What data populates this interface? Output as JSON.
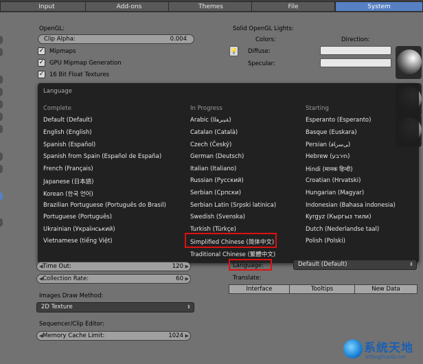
{
  "tabs": [
    "Input",
    "Add-ons",
    "Themes",
    "File",
    "System"
  ],
  "active_tab": "System",
  "opengl": {
    "heading": "OpenGL:",
    "clip_alpha_label": "Clip Alpha:",
    "clip_alpha_value": "0.004",
    "mipmaps_label": "Mipmaps",
    "gpu_mipmap_label": "GPU Mipmap Generation",
    "float_textures_label": "16 Bit Float Textures",
    "check_mark": "✓"
  },
  "solid_lights": {
    "heading": "Solid OpenGL Lights:",
    "colors_label": "Colors:",
    "direction_label": "Direction:",
    "diffuse_label": "Diffuse:",
    "specular_label": "Specular:"
  },
  "language_menu": {
    "title": "Language",
    "columns": [
      {
        "heading": "Complete",
        "items": [
          "Default (Default)",
          "English (English)",
          "Spanish (Español)",
          "Spanish from Spain (Español de España)",
          "French (Français)",
          "Japanese (日本語)",
          "Korean (한국 언어)",
          "Brazilian Portuguese (Português do Brasil)",
          "Portuguese (Português)",
          "Ukrainian (Український)",
          "Vietnamese (tiếng Việt)"
        ]
      },
      {
        "heading": "In Progress",
        "items": [
          "Arabic (ﺔﻴﺑﺮﻌﻟﺍ)",
          "Catalan (Català)",
          "Czech (Český)",
          "German (Deutsch)",
          "Italian (Italiano)",
          "Russian (Русский)",
          "Serbian (Српски)",
          "Serbian Latin (Srpski latinica)",
          "Swedish (Svenska)",
          "Turkish (Türkçe)",
          "Simplified Chinese (简体中文)",
          "Traditional Chinese (繁體中文)"
        ]
      },
      {
        "heading": "Starting",
        "items": [
          "Esperanto (Esperanto)",
          "Basque (Euskara)",
          "Persian (ﯽﺳﺭﺎﻓ)",
          "Hebrew (תירבע)",
          "Hindi (मानक हिन्दी)",
          "Croatian (Hrvatski)",
          "Hungarian (Magyar)",
          "Indonesian (Bahasa indonesia)",
          "Kyrgyz (Кыргыз тили)",
          "Dutch (Nederlandse taal)",
          "Polish (Polski)"
        ]
      }
    ]
  },
  "memory": {
    "time_out_label": "Time Out:",
    "time_out_value": "120",
    "collection_rate_label": "Collection Rate:",
    "collection_rate_value": "60"
  },
  "images_draw": {
    "heading": "Images Draw Method:",
    "value": "2D Texture"
  },
  "sequencer": {
    "heading": "Sequencer/Clip Editor:",
    "memory_cache_label": "Memory Cache Limit:",
    "memory_cache_value": "1024"
  },
  "language": {
    "label": "Language:",
    "value": "Default (Default)",
    "translate_label": "Translate:",
    "buttons": [
      "Interface",
      "Tooltips",
      "New Data"
    ]
  },
  "watermark": {
    "title": "系统天地",
    "url": "XiTongTianDi.net"
  },
  "colors": {
    "accent": "#5680c2",
    "highlight_box": "#e01010"
  }
}
